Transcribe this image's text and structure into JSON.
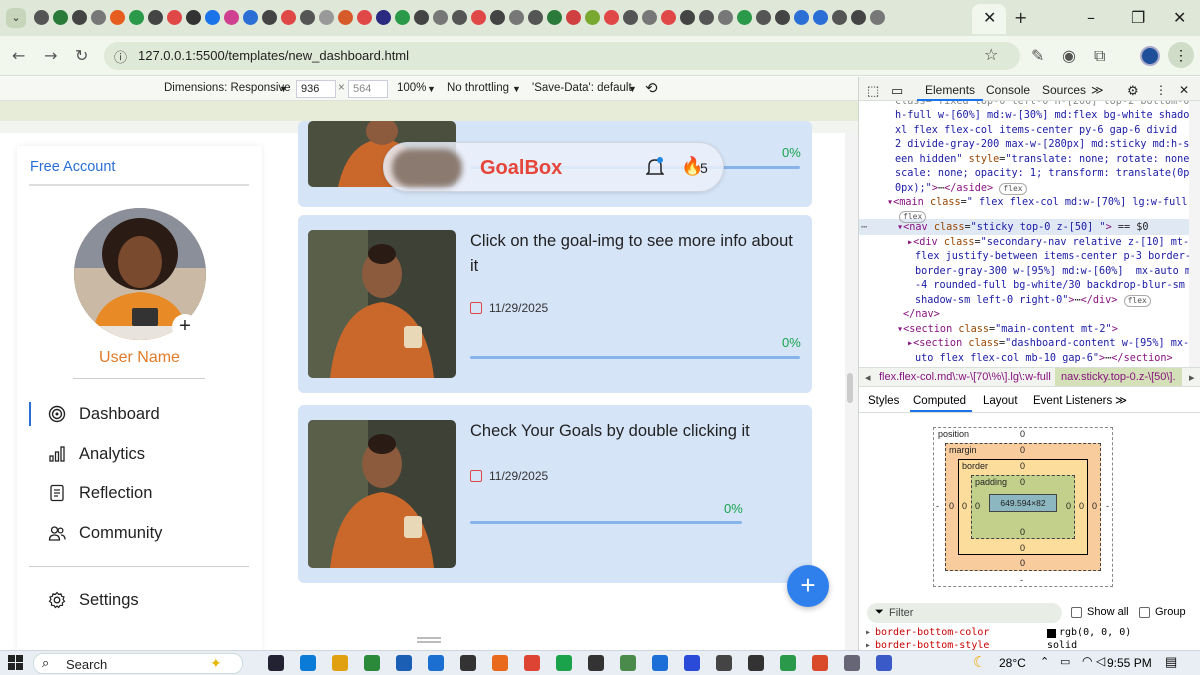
{
  "browser": {
    "url": "127.0.0.1:5500/templates/new_dashboard.html",
    "tab_colors": [
      "#555",
      "#2a7a3a",
      "#444",
      "#777",
      "#e65d1f",
      "#2a9a4a",
      "#444",
      "#e04848",
      "#333",
      "#1a73e8",
      "#d04090",
      "#2b6fd6",
      "#444",
      "#e04848",
      "#555",
      "#999",
      "#d65a2a",
      "#e04848",
      "#2a2a80",
      "#2a9a4a",
      "#444",
      "#777",
      "#555",
      "#e04848",
      "#444",
      "#777",
      "#555",
      "#2a7a3a",
      "#d04040",
      "#79a830",
      "#e04848",
      "#555",
      "#777",
      "#e04848",
      "#444",
      "#555",
      "#777",
      "#2a9a4a",
      "#555",
      "#444",
      "#2b6fd6",
      "#2b6fd6",
      "#555",
      "#444",
      "#777"
    ]
  },
  "devtools_bar": {
    "dimensions_label": "Dimensions: Responsive",
    "width": "936",
    "height": "564",
    "zoom": "100%",
    "throttling": "No throttling",
    "save_data": "'Save-Data': default"
  },
  "sidebar": {
    "free_account": "Free Account",
    "username": "User Name",
    "avatar_plus": "+",
    "items": [
      {
        "label": "Dashboard"
      },
      {
        "label": "Analytics"
      },
      {
        "label": "Reflection"
      },
      {
        "label": "Community"
      }
    ],
    "settings": "Settings"
  },
  "goalnav": {
    "brand": "GoalBox",
    "streak": "5",
    "first_card_pct": "0%"
  },
  "cards": [
    {
      "title": "Click on the goal-img to see more info about it",
      "date": "11/29/2025",
      "progress_pct": "0%",
      "progress_value": 0
    },
    {
      "title": "Check Your Goals by double clicking it",
      "date": "11/29/2025",
      "progress_pct": "0%",
      "progress_value": 0
    }
  ],
  "fab": "+",
  "devtools": {
    "tabs": [
      "Elements",
      "Console",
      "Sources"
    ],
    "breadcrumbs": [
      "flex.flex-col.md\\:w-\\[70\\%\\].lg\\:w-full",
      "nav.sticky.top-0.z-\\[50\\]."
    ],
    "styles_tabs": [
      "Styles",
      "Computed",
      "Layout",
      "Event Listeners"
    ],
    "box_model": {
      "position_label": "position",
      "margin_label": "margin",
      "border_label": "border",
      "padding_label": "padding",
      "content": "649.594×82",
      "zero": "0",
      "dash": "-"
    },
    "filter_placeholder": "Filter",
    "show_all": "Show all",
    "group": "Group",
    "prop1": "border-bottom-color",
    "prop1_val": "rgb(0, 0, 0)",
    "prop2": "border-bottom-style",
    "prop2_val": "solid"
  },
  "taskbar": {
    "search": "Search",
    "temp": "28°C",
    "time": "9:55 PM"
  }
}
